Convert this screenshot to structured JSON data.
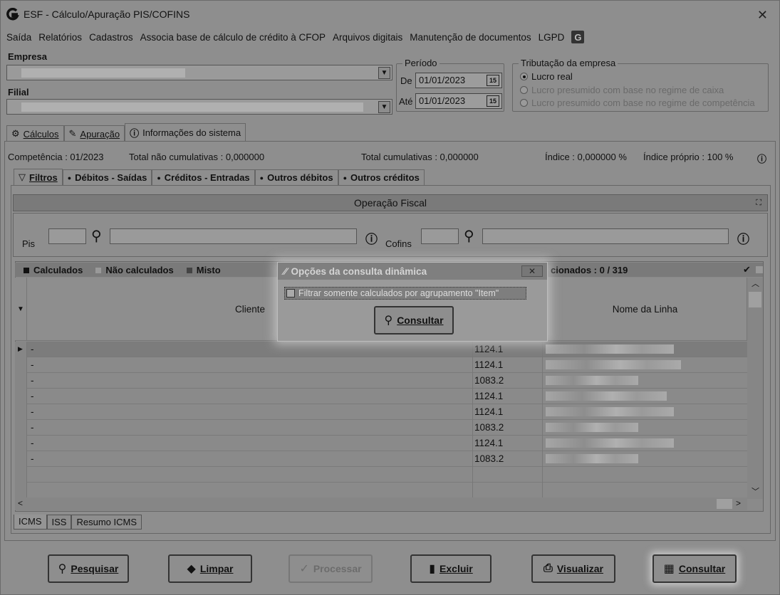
{
  "window": {
    "title": "ESF - Cálculo/Apuração PIS/COFINS",
    "close_glyph": "✕"
  },
  "menu": [
    "Saída",
    "Relatórios",
    "Cadastros",
    "Associa base de cálculo de crédito à CFOP",
    "Arquivos digitais",
    "Manutenção de documentos",
    "LGPD"
  ],
  "form": {
    "empresa_label": "Empresa",
    "filial_label": "Filial",
    "periodo": {
      "legend": "Período",
      "de_label": "De",
      "de_value": "01/01/2023",
      "ate_label": "Até",
      "ate_value": "01/01/2023",
      "cal_glyph": "15"
    },
    "tributacao": {
      "legend": "Tributação da empresa",
      "options": [
        {
          "label": "Lucro real",
          "selected": true,
          "enabled": true
        },
        {
          "label": "Lucro presumido com base no regime de caixa",
          "selected": false,
          "enabled": false
        },
        {
          "label": "Lucro presumido com base no regime de competência",
          "selected": false,
          "enabled": false
        }
      ]
    }
  },
  "main_tabs": [
    {
      "label": "Cálculos",
      "active": true
    },
    {
      "label": "Apuração",
      "active": false
    },
    {
      "label": "Informações do sistema",
      "active": false
    }
  ],
  "summary": {
    "competencia": "Competência : 01/2023",
    "total_nao_cumulativas": "Total não cumulativas : 0,000000",
    "total_cumulativas": "Total cumulativas : 0,000000",
    "indice": "Índice : 0,000000 %",
    "indice_proprio": "Índice próprio : 100 %"
  },
  "sub_tabs": [
    {
      "label": "Filtros"
    },
    {
      "label": "Débitos - Saídas",
      "active": true
    },
    {
      "label": "Créditos - Entradas"
    },
    {
      "label": "Outros débitos"
    },
    {
      "label": "Outros créditos"
    }
  ],
  "operacao_fiscal": {
    "title": "Operação Fiscal",
    "pis_label": "Pis",
    "cofins_label": "Cofins"
  },
  "grid": {
    "legend": [
      "Calculados",
      "Não calculados",
      "Misto"
    ],
    "selected_count": "cionados : 0 / 319",
    "columns": [
      "Cliente",
      "Nome da Linha"
    ],
    "rows": [
      {
        "cliente": "-",
        "cod": "1124.1",
        "selected": true
      },
      {
        "cliente": "-",
        "cod": "1124.1"
      },
      {
        "cliente": "-",
        "cod": "1083.2"
      },
      {
        "cliente": "-",
        "cod": "1124.1"
      },
      {
        "cliente": "-",
        "cod": "1124.1"
      },
      {
        "cliente": "-",
        "cod": "1083.2"
      },
      {
        "cliente": "-",
        "cod": "1124.1"
      },
      {
        "cliente": "-",
        "cod": "1083.2"
      }
    ]
  },
  "dialog": {
    "title": "Opções da consulta dinâmica",
    "checkbox_label": "Filtrar somente calculados por agrupamento \"Item\"",
    "button_label": "Consultar"
  },
  "bottom_tabs": [
    "ICMS",
    "ISS",
    "Resumo ICMS"
  ],
  "buttons": {
    "pesquisar": "Pesquisar",
    "limpar": "Limpar",
    "processar": "Processar",
    "excluir": "Excluir",
    "visualizar": "Visualizar",
    "consultar": "Consultar"
  }
}
